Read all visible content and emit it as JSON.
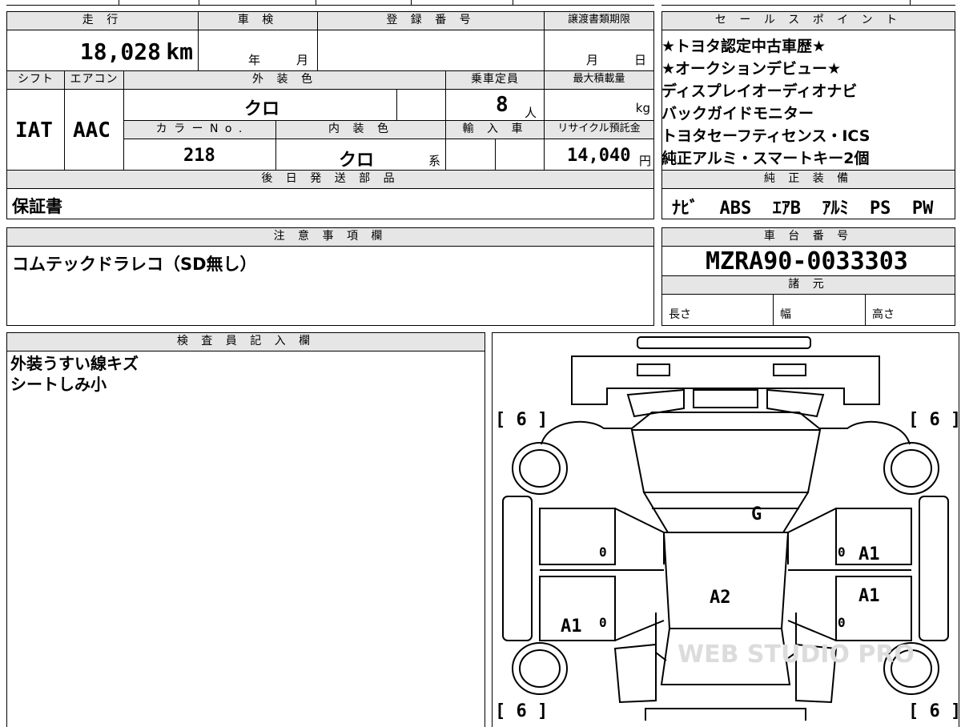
{
  "headers": {
    "mileage": "走 行",
    "inspection": "車 検",
    "registration": "登 録 番 号",
    "transfer_deadline": "譲渡書類期限",
    "shift": "シフト",
    "aircon": "エアコン",
    "exterior_color": "外 装 色",
    "capacity": "乗車定員",
    "max_load": "最大積載量",
    "color_no": "カ ラ ー N o .",
    "interior_color": "内 装 色",
    "import": "輸 入 車",
    "recycle": "リサイクル預託金",
    "follow_parts": "後 日 発 送 部 品",
    "sales_point": "セ ー ル ス ポ イ ン ト",
    "genuine_equipment": "純 正 装 備",
    "notes": "注 意 事 項 欄",
    "chassis": "車 台 番 号",
    "specs": "諸 元",
    "inspector": "検 査 員 記 入 欄"
  },
  "values": {
    "mileage": "18,028",
    "mileage_unit": "km",
    "inspection_year": "年",
    "inspection_month": "月",
    "transfer_month": "月",
    "transfer_day": "日",
    "shift": "IAT",
    "aircon": "AAC",
    "exterior_color": "クロ",
    "capacity": "8",
    "capacity_unit": "人",
    "max_load_unit": "kg",
    "color_no": "218",
    "interior_color": "クロ",
    "interior_suffix": "系",
    "recycle_fee": "14,040",
    "recycle_unit": "円",
    "follow_parts": "保証書",
    "genuine_equipment": "ﾅﾋﾞ  ABS  ｴｱB  ｱﾙﾐ  PS  PW",
    "notes": "コムテックドラレコ（SD無し）",
    "chassis": "MZRA90-0033303",
    "length_label": "長さ",
    "width_label": "幅",
    "height_label": "高さ"
  },
  "sales_points": [
    "★トヨタ認定中古車歴★",
    "★オークションデビュー★",
    "ディスプレイオーディオナビ",
    "バックガイドモニター",
    "トヨタセーフティセンス・ICS",
    "純正アルミ・スマートキー2個"
  ],
  "inspector_lines": [
    "外装うすい線キズ",
    "シートしみ小"
  ],
  "diagram": {
    "tire_front_left": "[ 6 ]",
    "tire_front_right": "[ 6 ]",
    "tire_rear_left": "[ 6 ]",
    "tire_rear_right": "[ 6 ]",
    "windshield": "G",
    "roof": "A2",
    "right_front_door": "A1",
    "right_rear_door": "A1",
    "left_rear_door": "A1",
    "zero_mark": "0",
    "watermark": "WEB STUDIO PRO"
  }
}
